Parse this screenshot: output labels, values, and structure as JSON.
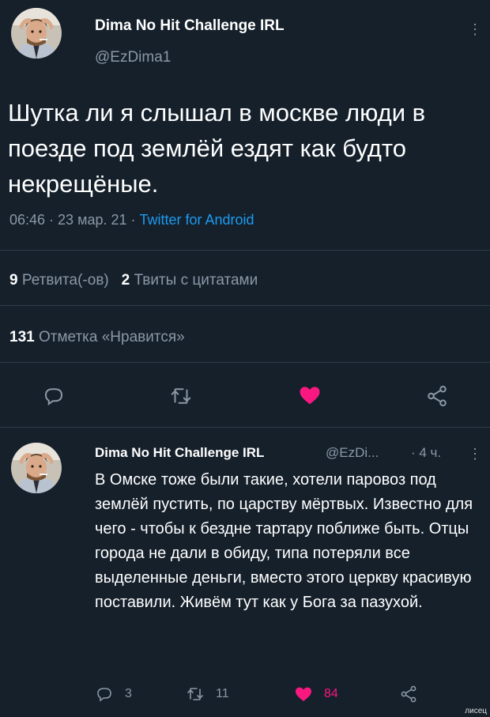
{
  "tweet": {
    "author_name": "Dima No Hit Challenge IRL",
    "author_handle": "@EzDima1",
    "text": "Шутка ли я слышал в москве люди в поезде под землёй ездят как будто некрещёные.",
    "time": "06:46",
    "date": "23 мар. 21",
    "source": "Twitter for Android",
    "separator": " · ",
    "retweets_count": "9",
    "retweets_label": "Ретвита(-ов)",
    "quotes_count": "2",
    "quotes_label": "Твиты с цитатами",
    "likes_count": "131",
    "likes_label": "Отметка «Нравится»"
  },
  "reply": {
    "author_name": "Dima No Hit Challenge IRL",
    "author_handle": "@EzDi...",
    "time": "· 4 ч.",
    "text": "В Омске тоже были такие, хотели паровоз под землёй пустить, по царству мёртвых. Известно для чего - чтобы к бездне тартару поближе быть. Отцы города не дали в обиду, типа потеряли все выделенные деньги, вместо этого церкву красивую поставили. Живём тут как у Бога за пазухой.",
    "replies": "3",
    "retweets": "11",
    "likes": "84"
  },
  "watermark": "лисец",
  "icons": {
    "reply": "reply-icon",
    "retweet": "retweet-icon",
    "like": "heart-icon",
    "share": "share-icon",
    "more": "more-vertical-icon"
  },
  "colors": {
    "background": "#15202b",
    "secondary_text": "#8b98a5",
    "link": "#1d9bf0",
    "like": "#f91880"
  }
}
